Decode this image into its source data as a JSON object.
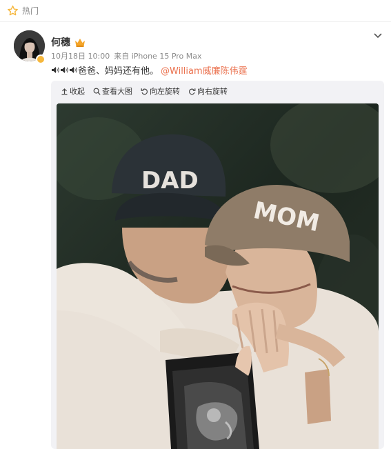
{
  "header": {
    "section_label": "热门"
  },
  "post": {
    "author": "何穗",
    "date": "10月18日 10:00",
    "source": "来自 iPhone 15 Pro Max",
    "text": "爸爸、妈妈还有他。",
    "mention": "@William威廉陈伟霆"
  },
  "toolbar": {
    "collapse": "收起",
    "view_large": "查看大图",
    "rotate_left": "向左旋转",
    "rotate_right": "向右旋转"
  },
  "photo": {
    "cap_dad_text": "DAD",
    "cap_mom_text": "MOM"
  },
  "colors": {
    "accent_orange": "#eb7350",
    "star": "#f6b73c",
    "meta_gray": "#8a8a8a"
  },
  "icons": [
    "star-icon",
    "crown-icon",
    "verified-icon",
    "chevron-down-icon",
    "speaker-icon",
    "collapse-icon",
    "magnifier-icon",
    "rotate-left-icon",
    "rotate-right-icon"
  ]
}
